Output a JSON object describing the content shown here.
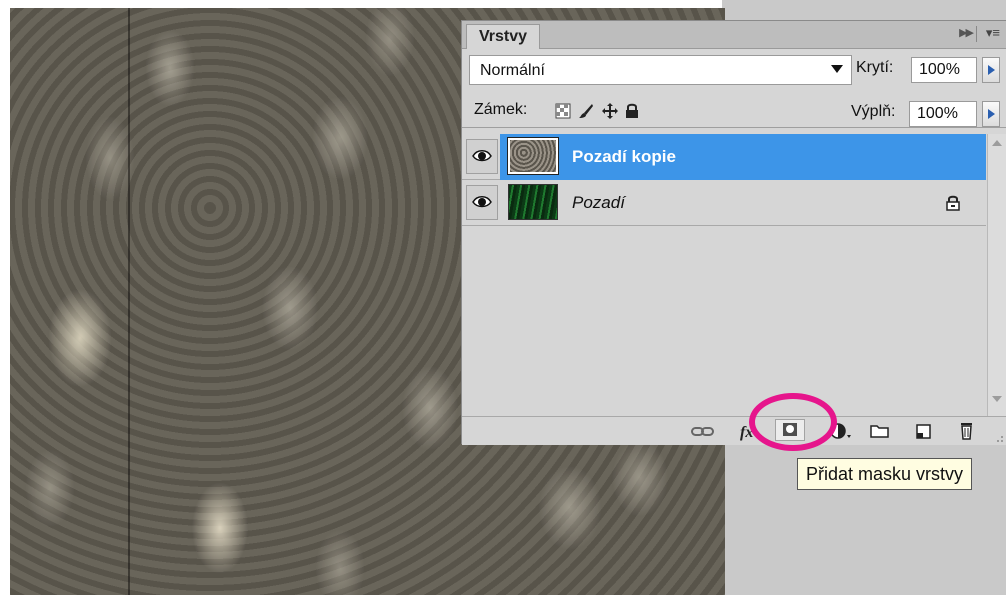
{
  "panel": {
    "tab_title": "Vrstvy",
    "blend_mode": "Normální",
    "opacity_label": "Krytí:",
    "opacity_value": "100%",
    "lock_label": "Zámek:",
    "fill_label": "Výplň:",
    "fill_value": "100%"
  },
  "layers": [
    {
      "name": "Pozadí kopie",
      "selected": true,
      "visible": true,
      "locked": false
    },
    {
      "name": "Pozadí",
      "selected": false,
      "visible": true,
      "locked": true
    }
  ],
  "toolbar": {
    "icons": [
      "link-layers-icon",
      "fx-style-icon",
      "add-mask-icon",
      "adjustment-layer-icon",
      "new-group-icon",
      "new-layer-icon",
      "delete-layer-icon"
    ]
  },
  "tooltip": {
    "text": "Přidat masku vrstvy"
  },
  "colors": {
    "selection": "#3d95e8",
    "highlight_ring": "#e6158c",
    "tooltip_bg": "#fffde1"
  }
}
